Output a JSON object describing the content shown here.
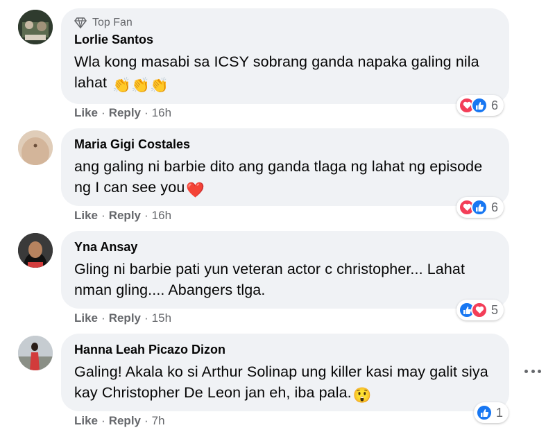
{
  "comments": [
    {
      "badge": "Top Fan",
      "author": "Lorlie Santos",
      "text": "Wla kong masabi sa ICSY sobrang ganda napaka galing nila lahat",
      "emoji": "👏👏👏",
      "like": "Like",
      "reply": "Reply",
      "time": "16h",
      "reaction_count": "6",
      "reactions": [
        "love-icon",
        "like-icon"
      ]
    },
    {
      "author": "Maria Gigi Costales",
      "text": "ang galing ni barbie dito ang ganda tlaga ng lahat ng episode ng I can see you",
      "emoji": "❤️",
      "like": "Like",
      "reply": "Reply",
      "time": "16h",
      "reaction_count": "6",
      "reactions": [
        "love-icon",
        "like-icon"
      ]
    },
    {
      "author": "Yna Ansay",
      "text": "Gling ni barbie pati yun veteran actor c christopher... Lahat nman gling.... Abangers tlga.",
      "like": "Like",
      "reply": "Reply",
      "time": "15h",
      "reaction_count": "5",
      "reactions": [
        "like-icon",
        "love-icon"
      ]
    },
    {
      "author": "Hanna Leah Picazo Dizon",
      "text": "Galing! Akala ko si Arthur Solinap ung killer kasi may galit siya kay Christopher De Leon jan eh, iba pala.",
      "emoji": "😲",
      "like": "Like",
      "reply": "Reply",
      "time": "7h",
      "reaction_count": "1",
      "reactions": [
        "like-icon"
      ]
    }
  ],
  "colors": {
    "bubble": "#f0f2f5",
    "meta": "#65676b",
    "like": "#1877f2",
    "love": "#f33e58"
  }
}
